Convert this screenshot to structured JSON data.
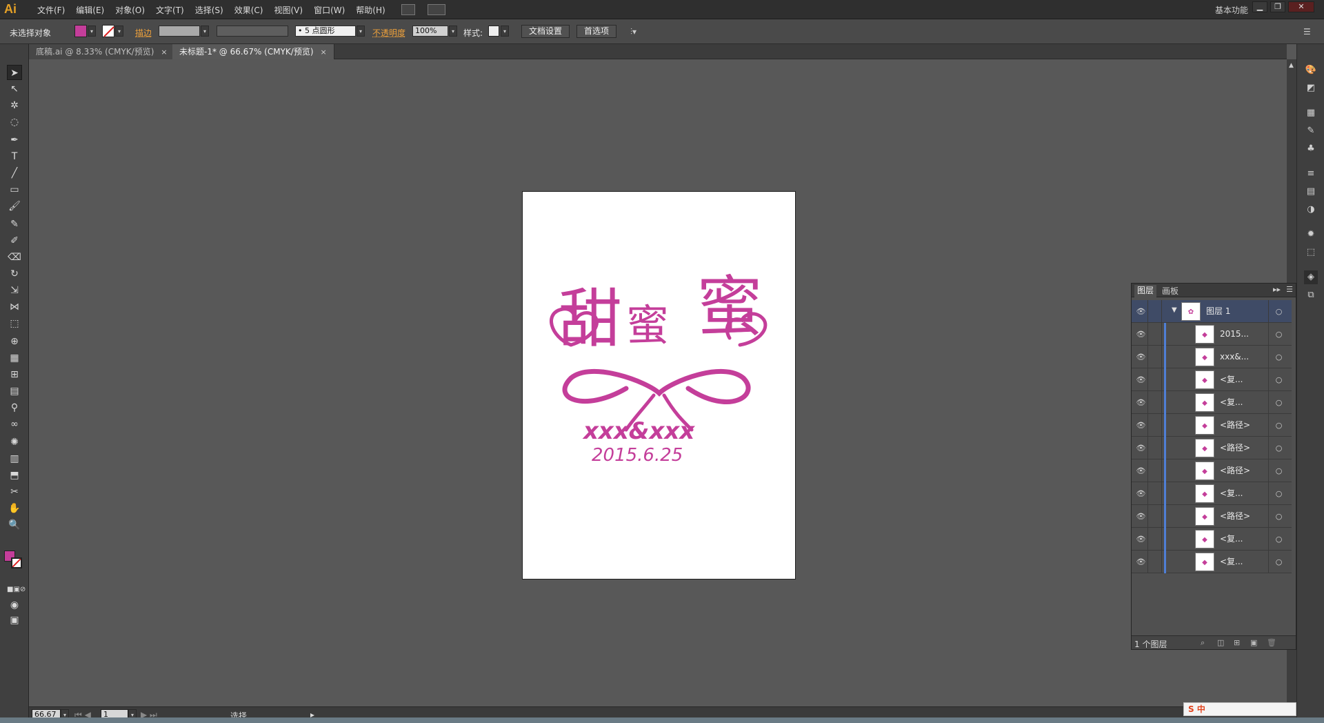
{
  "app": {
    "logo": "Ai"
  },
  "menu": [
    "文件(F)",
    "编辑(E)",
    "对象(O)",
    "文字(T)",
    "选择(S)",
    "效果(C)",
    "视图(V)",
    "窗口(W)",
    "帮助(H)"
  ],
  "workspace": {
    "label": "基本功能"
  },
  "window_controls": {
    "minimize": "▁",
    "restore": "❐",
    "close": "✕"
  },
  "control_bar": {
    "selection_status": "未选择对象",
    "fill_color": "#c43e9a",
    "stroke_label": "描边",
    "brush_label": "• 5 点圆形",
    "opacity_label": "不透明度",
    "opacity_value": "100%",
    "style_label": "样式:",
    "doc_setup_button": "文档设置",
    "preferences_button": "首选项"
  },
  "tabs": [
    {
      "label": "底稿.ai @ 8.33% (CMYK/预览)",
      "close": "×"
    },
    {
      "label": "未标题-1* @ 66.67% (CMYK/预览)",
      "close": "×"
    }
  ],
  "status_bar": {
    "zoom_value": "66.67",
    "page_value": "1",
    "tool_label": "选择"
  },
  "artwork": {
    "title_chars": [
      "甜",
      "蜜",
      "蜜"
    ],
    "names": "xxx&xxx",
    "date": "2015.6.25",
    "color": "#c43e9a"
  },
  "layers_panel": {
    "tabs": [
      "图层",
      "画板"
    ],
    "layer_name": "图层 1",
    "items": [
      "2015...",
      "xxx&...",
      "<复...",
      "<复...",
      "<路径>",
      "<路径>",
      "<路径>",
      "<复...",
      "<路径>",
      "<复...",
      "<复..."
    ],
    "footer_count": "1 个图层"
  },
  "ime": {
    "label": "S 中"
  }
}
